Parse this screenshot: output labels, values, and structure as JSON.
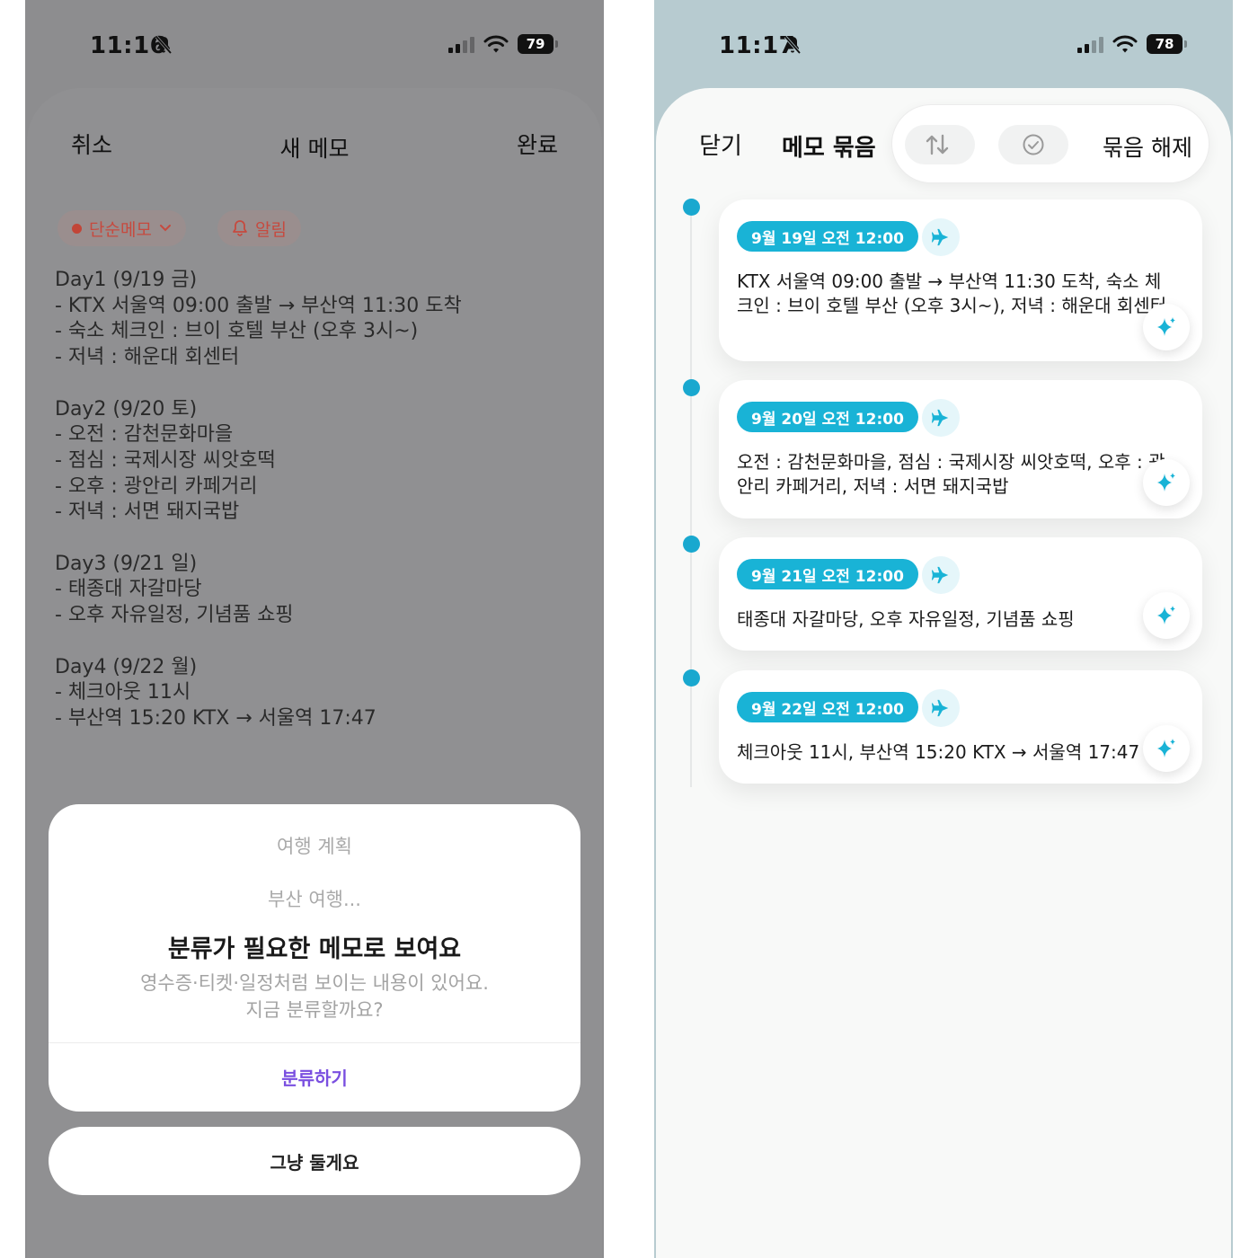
{
  "left_screen": {
    "status": {
      "time": "11:16",
      "battery": "79"
    },
    "header": {
      "cancel_label": "취소",
      "title": "새 메모",
      "done_label": "완료"
    },
    "chips": {
      "type_label": "단순메모",
      "alarm_label": "알림"
    },
    "memo_text": "Day1 (9/19 금)\n- KTX 서울역 09:00 출발 → 부산역 11:30 도착\n- 숙소 체크인 : 브이 호텔 부산 (오후 3시~)\n- 저녁 : 해운대 회센터\n\nDay2 (9/20 토)\n- 오전 : 감천문화마을\n- 점심 : 국제시장 씨앗호떡\n- 오후 : 광안리 카페거리\n- 저녁 : 서면 돼지국밥\n\nDay3 (9/21 일)\n- 태종대 자갈마당\n- 오후 자유일정, 기념품 쇼핑\n\nDay4 (9/22 월)\n- 체크아웃 11시\n- 부산역 15:20 KTX → 서울역 17:47",
    "alert": {
      "category": "여행 계획",
      "preview": "부산 여행...",
      "title": "분류가 필요한 메모로 보여요",
      "message": "영수증·티켓·일정처럼 보이는 내용이 있어요.\n지금 분류할까요?",
      "confirm_label": "분류하기",
      "dismiss_label": "그냥 둘게요"
    }
  },
  "right_screen": {
    "status": {
      "time": "11:17",
      "battery": "78"
    },
    "header": {
      "close_label": "닫기",
      "title": "메모 묶음",
      "ungroup_label": "묶음 해제"
    },
    "timeline": [
      {
        "date": "9월 19일 오전 12:00",
        "text": "KTX 서울역 09:00 출발 → 부산역 11:30 도착, 숙소 체크인 : 브이 호텔 부산 (오후 3시~), 저녁 : 해운대 회센터"
      },
      {
        "date": "9월 20일 오전 12:00",
        "text": "오전 : 감천문화마을, 점심 : 국제시장 씨앗호떡, 오후 : 광안리 카페거리, 저녁 : 서면 돼지국밥"
      },
      {
        "date": "9월 21일 오전 12:00",
        "text": "태종대 자갈마당, 오후 자유일정, 기념품 쇼핑"
      },
      {
        "date": "9월 22일 오전 12:00",
        "text": "체크아웃 11시, 부산역 15:20 KTX → 서울역 17:47"
      }
    ]
  },
  "colors": {
    "accent_teal": "#19b3d6",
    "accent_purple": "#7a4fe0",
    "chip_red": "#c64a3f"
  },
  "icons": [
    "bell-slash-icon",
    "signal-icon",
    "wifi-icon",
    "battery-icon",
    "chevron-down-icon",
    "bell-icon",
    "sort-icon",
    "check-circle-icon",
    "airplane-icon",
    "sparkle-icon"
  ]
}
